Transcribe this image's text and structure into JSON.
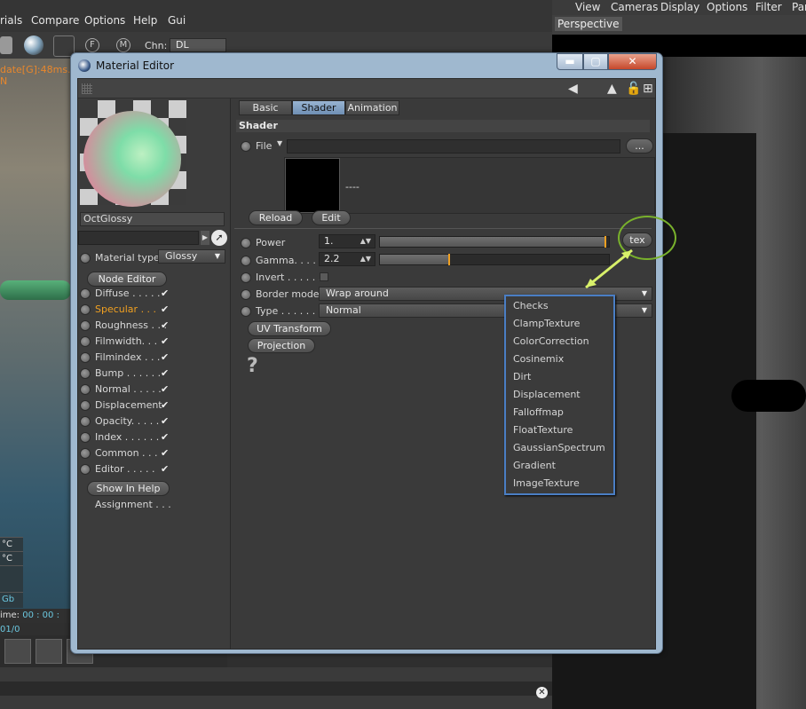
{
  "bg_app": {
    "menu": [
      "rials",
      "Compare",
      "Options",
      "Help",
      "Gui"
    ],
    "chn_label": "Chn:",
    "chn_value": "DL",
    "status_orange": "date[G]:48ms. N",
    "status_rows": [
      "°C",
      "°C",
      "",
      "Gb"
    ],
    "time_label": "ime:",
    "time_value": "00 : 00 : 01/0"
  },
  "right_view": {
    "menu": [
      "View",
      "Cameras",
      "Display",
      "Options",
      "Filter",
      "Par"
    ],
    "tab": "Perspective"
  },
  "window": {
    "title": "Material Editor",
    "min": "▬",
    "max": "▢",
    "close": "✕"
  },
  "left_panel": {
    "material_name": "OctGlossy",
    "material_type_label": "Material type",
    "material_type_value": "Glossy",
    "node_editor": "Node Editor",
    "channels": [
      {
        "label": "Diffuse . . . . .",
        "checked": true,
        "color": "#d8d8d8"
      },
      {
        "label": "Specular . . .",
        "checked": true,
        "color": "#f0a021"
      },
      {
        "label": "Roughness . . .",
        "checked": true,
        "color": "#d8d8d8"
      },
      {
        "label": "Filmwidth. . .",
        "checked": true,
        "color": "#d8d8d8"
      },
      {
        "label": "Filmindex . . .",
        "checked": true,
        "color": "#d8d8d8"
      },
      {
        "label": "Bump . . . . . .",
        "checked": true,
        "color": "#d8d8d8"
      },
      {
        "label": "Normal . . . . .",
        "checked": true,
        "color": "#d8d8d8"
      },
      {
        "label": "Displacement",
        "checked": true,
        "color": "#d8d8d8"
      },
      {
        "label": "Opacity. . . . .",
        "checked": true,
        "color": "#d8d8d8"
      },
      {
        "label": "Index . . . . . .",
        "checked": true,
        "color": "#d8d8d8"
      },
      {
        "label": "Common . . .",
        "checked": true,
        "color": "#d8d8d8"
      },
      {
        "label": "Editor . . . . .",
        "checked": true,
        "color": "#d8d8d8"
      }
    ],
    "check_glyph": "✔",
    "show_in_help": "Show In Help",
    "assignment": "Assignment . . ."
  },
  "right_panel": {
    "tabs": [
      "Basic",
      "Shader",
      "Animation"
    ],
    "active_tab": "Shader",
    "section": "Shader",
    "file_label": "File",
    "file_browse": "...",
    "thumb_text": "----",
    "reload": "Reload",
    "edit": "Edit",
    "power_label": "Power",
    "power_value": "1.",
    "power_fraction": 0.98,
    "gamma_label": "Gamma. . . . .",
    "gamma_value": "2.2",
    "gamma_fraction": 0.3,
    "tex_button": "tex",
    "invert_label": "Invert . . . . . .",
    "border_mode_label": "Border mode",
    "border_mode_value": "Wrap around",
    "type_label": "Type . . . . . . .",
    "type_value": "Normal",
    "uv_transform": "UV Transform",
    "projection": "Projection",
    "help_glyph": "?"
  },
  "tex_menu": [
    "Checks",
    "ClampTexture",
    "ColorCorrection",
    "Cosinemix",
    "Dirt",
    "Displacement",
    "Falloffmap",
    "FloatTexture",
    "GaussianSpectrum",
    "Gradient",
    "ImageTexture"
  ],
  "colors": {
    "accent_orange": "#f0a021",
    "annotation_green": "#79b12c",
    "menu_border_blue": "#4a7ec4",
    "active_tab_blue": "#7f9fc4"
  }
}
